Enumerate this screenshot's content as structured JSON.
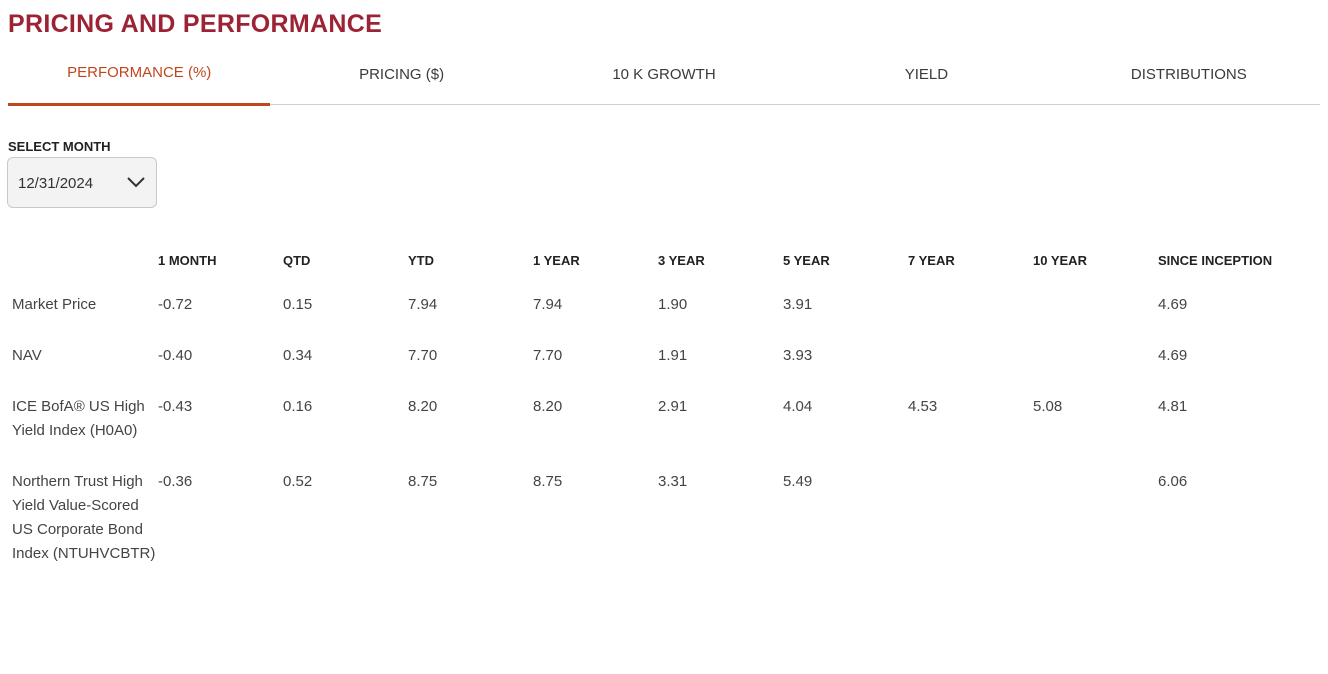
{
  "page": {
    "title": "PRICING AND PERFORMANCE"
  },
  "tabs": [
    {
      "label": "PERFORMANCE (%)",
      "active": true
    },
    {
      "label": "PRICING ($)",
      "active": false
    },
    {
      "label": "10 K GROWTH",
      "active": false
    },
    {
      "label": "YIELD",
      "active": false
    },
    {
      "label": "DISTRIBUTIONS",
      "active": false
    }
  ],
  "month_select": {
    "label": "SELECT MONTH",
    "value": "12/31/2024",
    "icon": "chevron-down-icon"
  },
  "table": {
    "headers": [
      "",
      "1 MONTH",
      "QTD",
      "YTD",
      "1 YEAR",
      "3 YEAR",
      "5 YEAR",
      "7 YEAR",
      "10 YEAR",
      "SINCE INCEPTION"
    ],
    "rows": [
      {
        "label": "Market Price",
        "values": [
          "-0.72",
          "0.15",
          "7.94",
          "7.94",
          "1.90",
          "3.91",
          "",
          "",
          "4.69"
        ]
      },
      {
        "label": "NAV",
        "values": [
          "-0.40",
          "0.34",
          "7.70",
          "7.70",
          "1.91",
          "3.93",
          "",
          "",
          "4.69"
        ]
      },
      {
        "label": "ICE BofA® US High Yield Index (H0A0)",
        "values": [
          "-0.43",
          "0.16",
          "8.20",
          "8.20",
          "2.91",
          "4.04",
          "4.53",
          "5.08",
          "4.81"
        ]
      },
      {
        "label": "Northern Trust High Yield Value-Scored US Corporate Bond Index (NTUHVCBTR)",
        "values": [
          "-0.36",
          "0.52",
          "8.75",
          "8.75",
          "3.31",
          "5.49",
          "",
          "",
          "6.06"
        ]
      }
    ]
  },
  "colors": {
    "title": "#9b2335",
    "active_tab": "#c0461e"
  }
}
